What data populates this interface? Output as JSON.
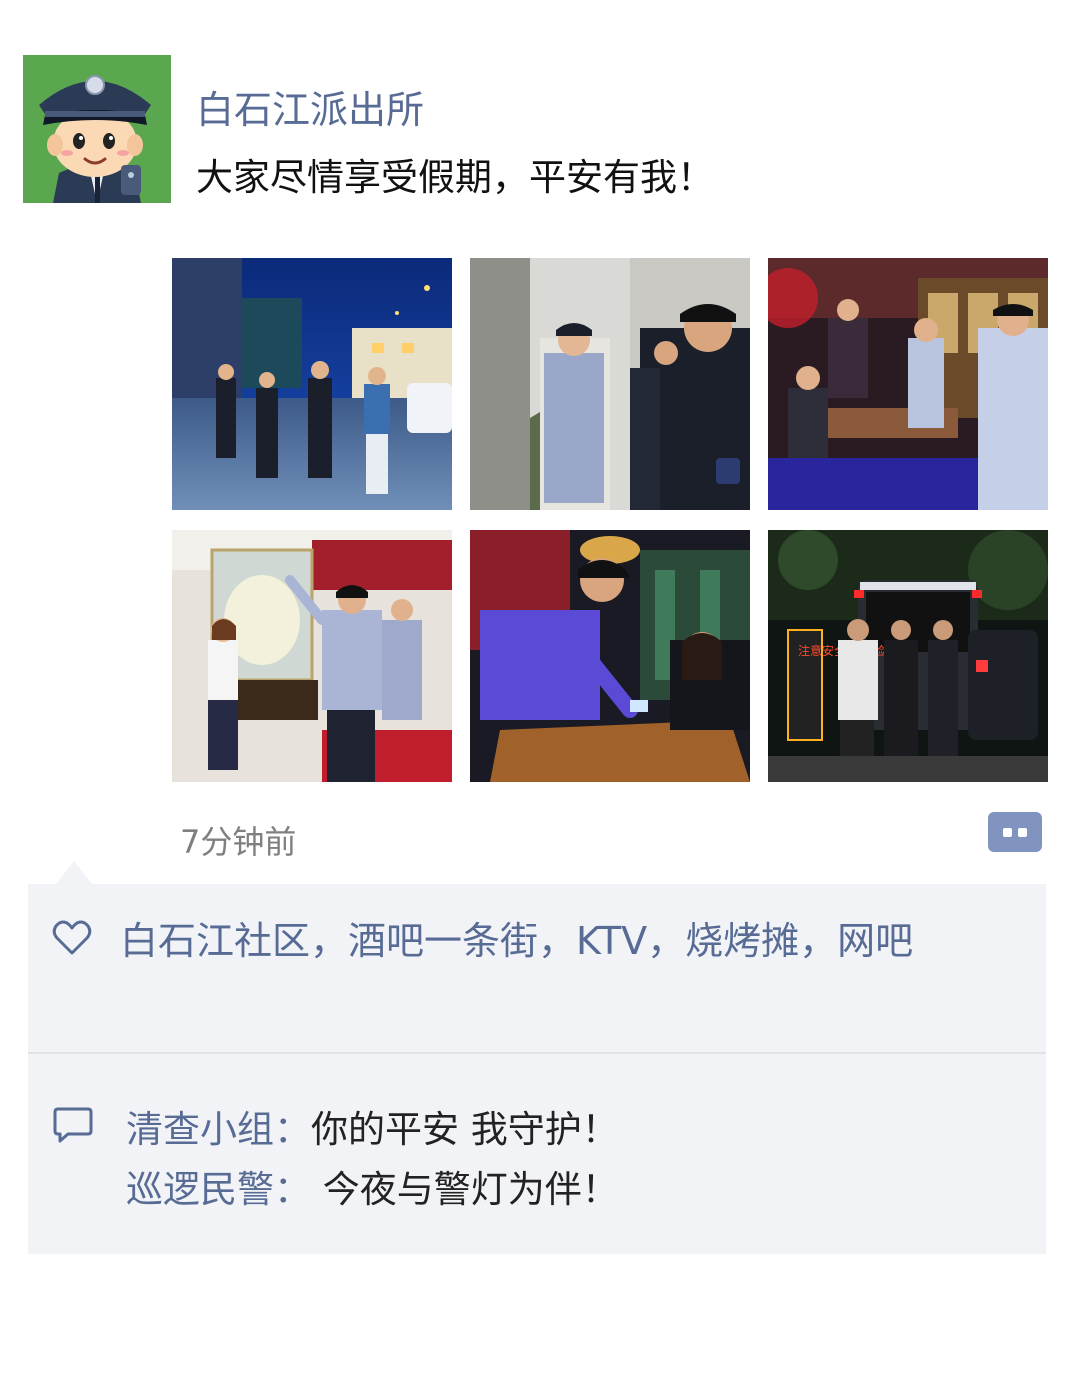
{
  "post": {
    "author": "白石江派出所",
    "text": "大家尽情享受假期，平安有我！",
    "timestamp": "7分钟前",
    "photo_count": 6,
    "photo_sign_text": "注意安全 公安检查"
  },
  "likes": {
    "text": "白石江社区，酒吧一条街，KTV，烧烤摊，网吧"
  },
  "comments": [
    {
      "author": "清查小组：",
      "text": "你的平安 我守护！"
    },
    {
      "author": "巡逻民警：",
      "text": " 今夜与警灯为伴！"
    }
  ],
  "colors": {
    "link": "#576b95",
    "panel": "#f2f3f6",
    "avatar_bg": "#5aa750",
    "more_button": "#8193bf"
  },
  "icons": {
    "like": "heart-icon",
    "comment": "comment-icon",
    "more": "more-options-icon"
  }
}
